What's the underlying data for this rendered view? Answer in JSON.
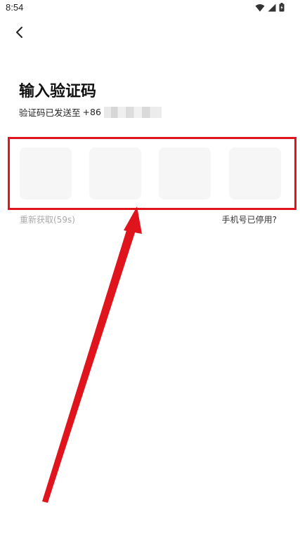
{
  "status_bar": {
    "time": "8:54",
    "icons": [
      "wifi-icon",
      "signal-icon",
      "battery-icon"
    ]
  },
  "nav": {
    "back_icon": "chevron-left-icon"
  },
  "header": {
    "title": "输入验证码",
    "subtitle_prefix": "验证码已发送至",
    "country_code": "+86"
  },
  "code_input": {
    "box_count": 4,
    "box_color": "#f6f6f6"
  },
  "actions": {
    "resend_label": "重新获取(59s)",
    "disabled_phone_label": "手机号已停用?"
  },
  "annotation": {
    "color": "#e0141c"
  }
}
